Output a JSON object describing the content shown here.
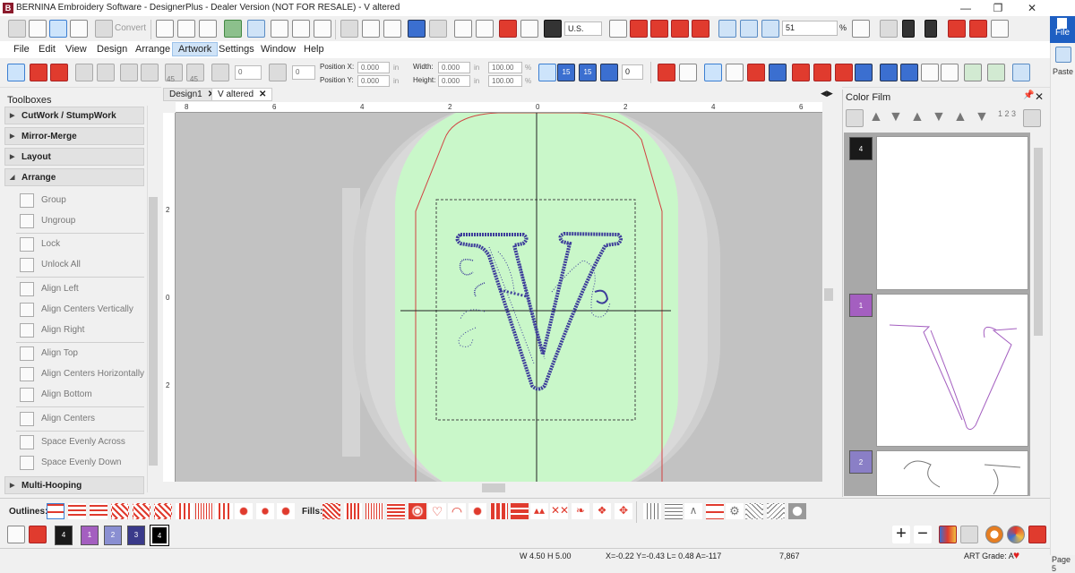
{
  "window": {
    "title": "BERNINA Embroidery Software - DesignerPlus - Dealer Version (NOT FOR RESALE) - V altered",
    "logo_letter": "B"
  },
  "toolbar": {
    "convert_label": "Convert",
    "units_value": "U.S.",
    "zoom_value": "51",
    "zoom_unit": "%",
    "rotate_value": "0",
    "skew_value": "0",
    "rotate45_label": "45",
    "angle_value": "0",
    "position_x_label": "Position X:",
    "position_y_label": "Position Y:",
    "position_x_value": "0.000",
    "position_y_value": "0.000",
    "width_label": "Width:",
    "height_label": "Height:",
    "width_value": "0.000",
    "height_value": "0.000",
    "scale_x_value": "100.00",
    "scale_y_value": "100.00",
    "unit_in": "in",
    "unit_pct": "%",
    "num15": "15",
    "num_sort": "1 2 3"
  },
  "menu": [
    "File",
    "Edit",
    "View",
    "Design",
    "Arrange",
    "Artwork",
    "Settings",
    "Window",
    "Help"
  ],
  "menu_active": "Artwork",
  "ribbon": {
    "file_label": "File",
    "paste_label": "Paste",
    "page_label": "Page 5"
  },
  "toolboxes": {
    "title": "Toolboxes",
    "categories": [
      {
        "label": "CutWork / StumpWork"
      },
      {
        "label": "Mirror-Merge"
      },
      {
        "label": "Layout"
      },
      {
        "label": "Arrange"
      },
      {
        "label": "Multi-Hooping"
      }
    ],
    "items": [
      "Group",
      "Ungroup",
      "Lock",
      "Unlock All",
      "Align Left",
      "Align Centers Vertically",
      "Align Right",
      "Align Top",
      "Align Centers Horizontally",
      "Align Bottom",
      "Align Centers",
      "Space Evenly Across",
      "Space Evenly Down"
    ]
  },
  "tabs": [
    {
      "label": "Design1"
    },
    {
      "label": "V altered"
    }
  ],
  "ruler": {
    "h_labels": [
      "8",
      "6",
      "4",
      "2",
      "0",
      "2",
      "4",
      "6"
    ],
    "v_labels": [
      "2",
      "0",
      "2"
    ]
  },
  "colorfilm": {
    "title": "Color Film",
    "entries": [
      {
        "number": "4",
        "color": "#1a1a1a"
      },
      {
        "number": "1",
        "color": "#a45fc0"
      },
      {
        "number": "2",
        "color": "#8a7fc6"
      }
    ]
  },
  "bottom": {
    "outlines_label": "Outlines:",
    "fills_label": "Fills:",
    "colors": [
      {
        "number": "4",
        "color": "#1a1a1a"
      },
      {
        "number": "1",
        "color": "#a45fc0"
      },
      {
        "number": "2",
        "color": "#8a8fd2"
      },
      {
        "number": "3",
        "color": "#3a3a8a"
      },
      {
        "number": "4",
        "color": "#000000"
      }
    ]
  },
  "status": {
    "size": "W 4.50 H 5.00",
    "coords": "X=-0.22 Y=-0.43 L= 0.48 A=-117",
    "stitches": "7,867",
    "grade": "ART Grade: A"
  },
  "accent_colors": {
    "hoop": "#c9f7c9",
    "stitch": "#3d3d9a",
    "red_tool": "#e03b2e",
    "file_blue": "#1e5fc2"
  }
}
